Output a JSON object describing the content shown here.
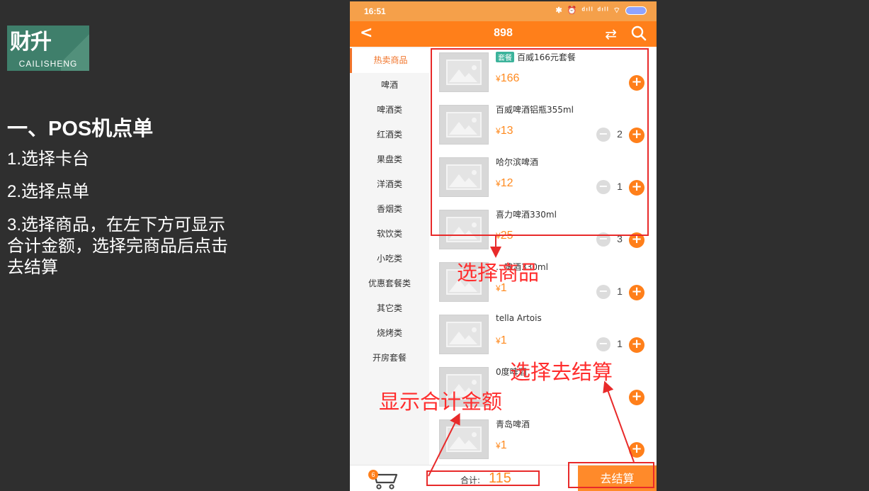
{
  "logo": {
    "main": "财升",
    "sub": "CAILISHENG"
  },
  "slide": {
    "title": "一、POS机点单",
    "steps": [
      "1.选择卡台",
      "2.选择点单",
      "3.选择商品，在左下方可显示合计金额，选择完商品后点击去结算"
    ]
  },
  "phone": {
    "status": {
      "time": "16:51",
      "icons": "✱ ⏰ ᵈᶦˡˡ ᵈᶦˡˡ ⌔"
    },
    "appbar": {
      "back": "<",
      "title": "898",
      "swap": "⇄"
    },
    "categories": [
      "热卖商品",
      "啤酒",
      "啤酒类",
      "红酒类",
      "果盘类",
      "洋酒类",
      "香烟类",
      "软饮类",
      "小吃类",
      "优惠套餐类",
      "其它类",
      "烧烤类",
      "开房套餐"
    ],
    "active_category": "热卖商品",
    "products": [
      {
        "tag": "套餐",
        "name": "百威166元套餐",
        "price": "166",
        "qty": ""
      },
      {
        "tag": "",
        "name": "百威啤酒铝瓶355ml",
        "price": "13",
        "qty": "2"
      },
      {
        "tag": "",
        "name": "哈尔滨啤酒",
        "price": "12",
        "qty": "1"
      },
      {
        "tag": "",
        "name": "喜力啤酒330ml",
        "price": "25",
        "qty": "3"
      },
      {
        "tag": "",
        "name": "…啤酒330ml",
        "price": "1",
        "qty": "1"
      },
      {
        "tag": "",
        "name": "tella Artois",
        "price": "1",
        "qty": "1"
      },
      {
        "tag": "",
        "name": "0度啤酒",
        "price": "",
        "qty": ""
      },
      {
        "tag": "",
        "name": "青岛啤酒",
        "price": "1",
        "qty": ""
      }
    ],
    "currency": "¥",
    "minus": "−",
    "plus": "+",
    "bottom": {
      "cart_count": "6",
      "total_label": "合计:",
      "total_value": "115",
      "checkout_label": "去结算"
    }
  },
  "annotations": {
    "select_product": "选择商品",
    "show_total": "显示合计金额",
    "select_checkout": "选择去结算"
  },
  "colors": {
    "accent": "#ff7f1a",
    "annotation": "#e82a2a",
    "background": "#2f2f2f"
  }
}
